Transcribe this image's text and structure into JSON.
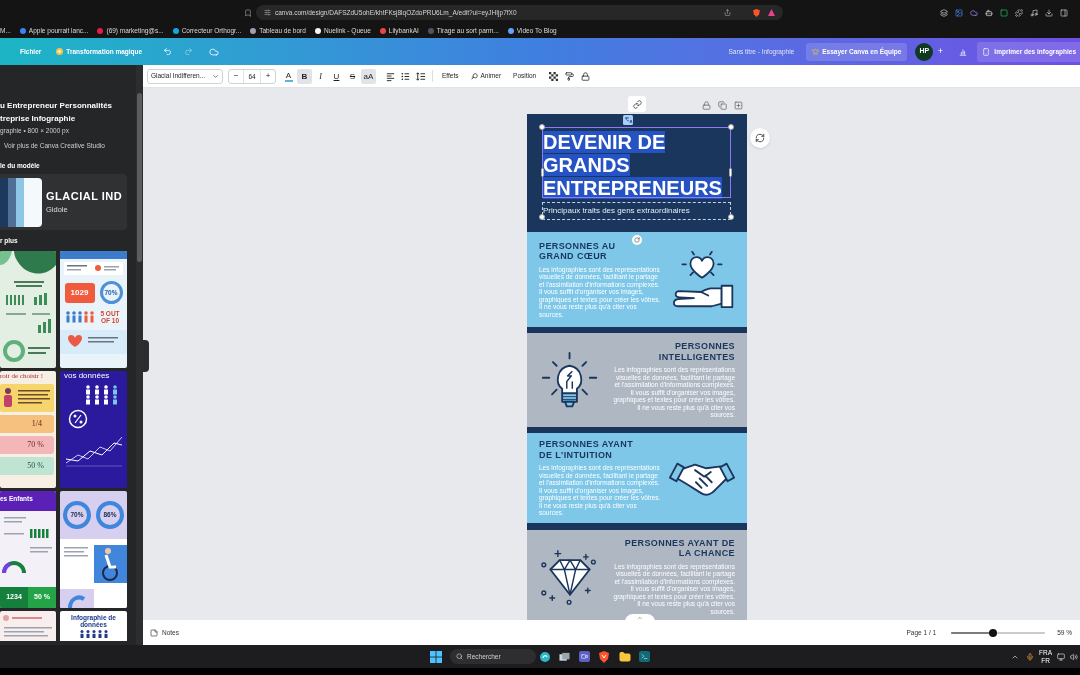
{
  "browser": {
    "address": "canva.com/design/DAFSZdU5ohE/khtFKsj8lqOZdoPRU6Lm_A/edit?ui=eyJHIjp7fX0",
    "bookmarks": [
      {
        "label": "M..."
      },
      {
        "label": "Apple pourrait lanc...",
        "color": "#3b82f6"
      },
      {
        "label": "(69) marketing@s...",
        "color": "#e11d48"
      },
      {
        "label": "Correcteur Orthogr...",
        "color": "#0ea5e9"
      },
      {
        "label": "Tableau de bord",
        "color": "#9ca3af"
      },
      {
        "label": "Nuelink - Queue",
        "color": "#f5f5f5"
      },
      {
        "label": "LilybankAI",
        "color": "#ef4444"
      },
      {
        "label": "Tirage au sort parm...",
        "color": "#4b5563"
      },
      {
        "label": "Video To Blog",
        "color": "#60a5fa"
      }
    ]
  },
  "header": {
    "menu": [
      "Fichier",
      "Transformation magique"
    ],
    "doc_title": "Sans titre - Infographie",
    "team_button": "Essayer Canva en Équipe",
    "avatar": "HP",
    "add": "+",
    "print_button": "Imprimer des infographies"
  },
  "toolbar": {
    "font": "Glacial Indifferen...",
    "decrease": "−",
    "size": "64",
    "increase": "+",
    "styles": [
      {
        "label": "A",
        "kind": "color",
        "color": "#5fb3d9",
        "selected": false
      },
      {
        "label": "B",
        "kind": "bold",
        "selected": true
      },
      {
        "label": "I",
        "kind": "italic",
        "selected": false
      },
      {
        "label": "U",
        "kind": "underline",
        "selected": false
      },
      {
        "label": "S",
        "kind": "strike",
        "selected": false
      },
      {
        "label": "aA",
        "kind": "case",
        "selected": true
      }
    ],
    "actions": [
      {
        "label": "Effets",
        "kind": "effects"
      },
      {
        "label": "Animer",
        "kind": "animate"
      },
      {
        "label": "Position",
        "kind": "position"
      }
    ]
  },
  "left_panel": {
    "title_lines": [
      "u Entrepreneur Personnalités",
      "treprise Infographie"
    ],
    "meta": "graphie • 800 × 2000 px",
    "creator_link": "Voir plus de Canva Creative Studio",
    "style_heading": "le du modèle",
    "style_card": {
      "swatches": [
        {
          "color": "#1d3a5e"
        },
        {
          "color": "#4f6f96"
        },
        {
          "color": "#8ec6e6"
        },
        {
          "color": "#f4f9fc"
        }
      ],
      "font_title": "GLACIAL IND",
      "font_subtitle": "Gidole"
    },
    "more_heading": "r plus",
    "thumbnails": [
      {
        "kind": "green"
      },
      {
        "kind": "stats",
        "texts": [
          "1029",
          "70%",
          "5 OUT OF 10"
        ]
      },
      {
        "kind": "rights",
        "texts": [
          "roit de choisir !",
          "1/4",
          "70 %",
          "50 %"
        ]
      },
      {
        "kind": "data",
        "texts": [
          "vos données"
        ]
      },
      {
        "kind": "kids",
        "texts": [
          "es Enfants",
          "1234",
          "50 %"
        ]
      },
      {
        "kind": "donuts",
        "texts": [
          "70%",
          "86%"
        ]
      },
      {
        "kind": "report"
      },
      {
        "kind": "infographic",
        "texts": [
          "Infographie de données"
        ]
      }
    ]
  },
  "design": {
    "title_lines": [
      "DEVENIR DE",
      "GRANDS",
      "ENTREPRENEURS"
    ],
    "title_selected": true,
    "subtitle": "Principaux traits des gens extraordinaires",
    "sections": [
      {
        "kind": "heart",
        "icon_left": false,
        "color": "#7ec7e8",
        "title_lines": [
          "PERSONNES AU",
          "GRAND CŒUR"
        ],
        "body": "Les infographies sont des représentations visuelles de données, facilitant le partage et l'assimilation d'informations complexes. Il vous suffit d'organiser vos images, graphiques et textes pour créer les vôtres. Il ne vous reste plus qu'à citer vos sources."
      },
      {
        "kind": "bulb",
        "icon_left": true,
        "color": "#aeb7c2",
        "title_lines": [
          "PERSONNES",
          "INTELLIGENTES"
        ],
        "body": "Les infographies sont des représentations visuelles de données, facilitant le partage et l'assimilation d'informations complexes. Il vous suffit d'organiser vos images, graphiques et textes pour créer les vôtres. Il ne vous reste plus qu'à citer vos sources."
      },
      {
        "kind": "handshake",
        "icon_left": false,
        "color": "#7ec7e8",
        "title_lines": [
          "PERSONNES AYANT",
          "DE L'INTUITION"
        ],
        "body": "Les infographies sont des représentations visuelles de données, facilitant le partage et l'assimilation d'informations complexes. Il vous suffit d'organiser vos images, graphiques et textes pour créer les vôtres. Il ne vous reste plus qu'à citer vos sources."
      },
      {
        "kind": "diamond",
        "icon_left": true,
        "color": "#aeb7c2",
        "title_lines": [
          "PERSONNES AYANT DE",
          "LA CHANCE"
        ],
        "body": "Les infographies sont des représentations visuelles de données, facilitant le partage et l'assimilation d'informations complexes. Il vous suffit d'organiser vos images, graphiques et textes pour créer les vôtres. Il ne vous reste plus qu'à citer vos sources."
      }
    ]
  },
  "bottom_bar": {
    "notes": "Notes",
    "page": "Page 1 / 1",
    "zoom": {
      "level": 0.45
    },
    "zoom_reading": "59 %"
  },
  "taskbar": {
    "search_placeholder": "Rechercher",
    "language": [
      "FRA",
      "FR"
    ]
  }
}
